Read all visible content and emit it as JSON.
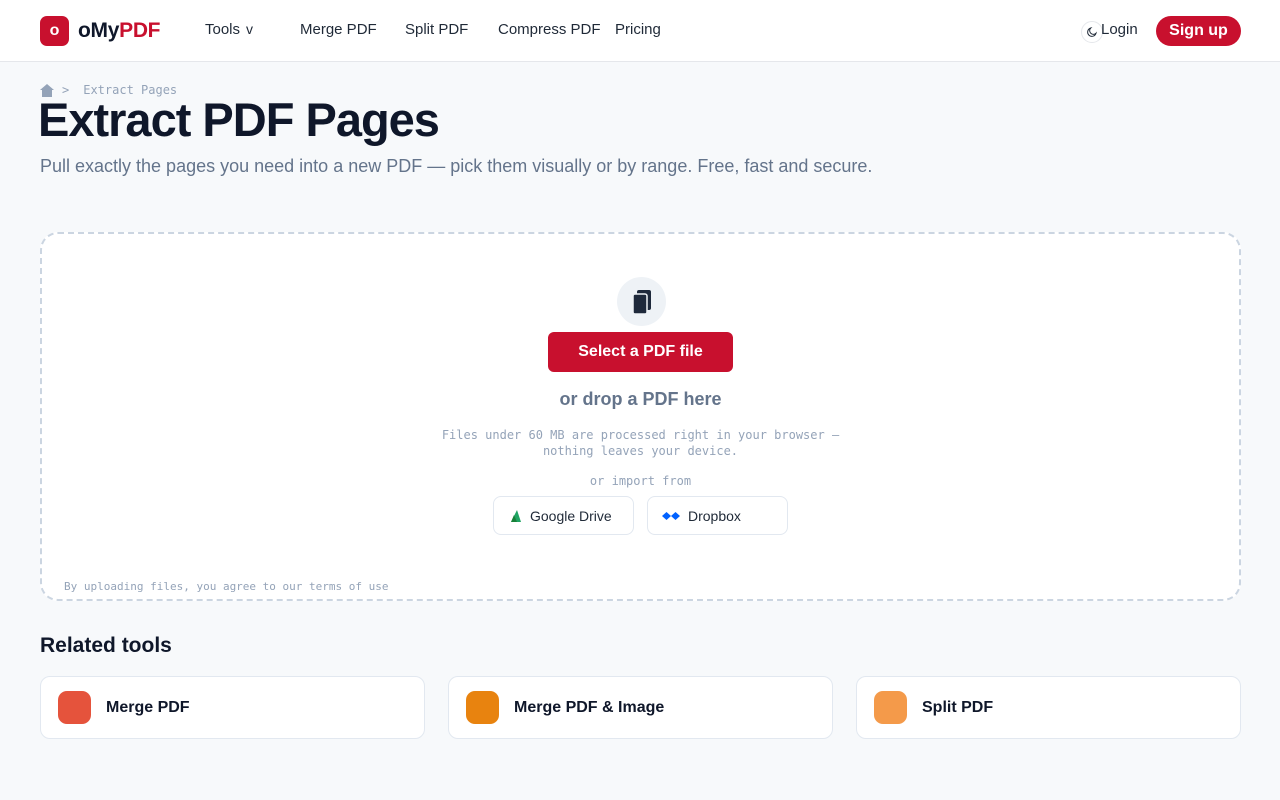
{
  "brand": {
    "mark": "o",
    "name_part1": "oMy",
    "name_part2": "PDF",
    "accent_color": "#c8102e"
  },
  "nav": {
    "tools_label": "Tools",
    "tools_chevron": "v",
    "merge_label": "Merge PDF",
    "split_label": "Split PDF",
    "compress_label": "Compress PDF",
    "pricing_label": "Pricing"
  },
  "account": {
    "theme_icon": "moon-icon",
    "login_label": "Login",
    "signup_label": "Sign up"
  },
  "breadcrumb": {
    "home_icon": "home-icon",
    "separator": ">",
    "current": "Extract Pages"
  },
  "hero": {
    "title": "Extract PDF Pages",
    "subtitle": "Pull exactly the pages you need into a new PDF — pick them visually or by range. Free, fast and secure."
  },
  "dropzone": {
    "icon": "pages-icon",
    "select_label": "Select a PDF file",
    "drop_label": "or drop a PDF here",
    "note_line1": "Files under 60 MB are processed right in your browser —",
    "note_line2": "nothing leaves your device.",
    "import_label": "or import from",
    "gdrive_label": "Google Drive",
    "dropbox_label": "Dropbox",
    "terms": "By uploading files, you agree to our terms of use"
  },
  "related": {
    "title": "Related tools",
    "tools": [
      {
        "label": "Merge PDF",
        "color": "#e5533c"
      },
      {
        "label": "Merge PDF & Image",
        "color": "#e8830f"
      },
      {
        "label": "Split PDF",
        "color": "#f49a4a"
      }
    ]
  }
}
